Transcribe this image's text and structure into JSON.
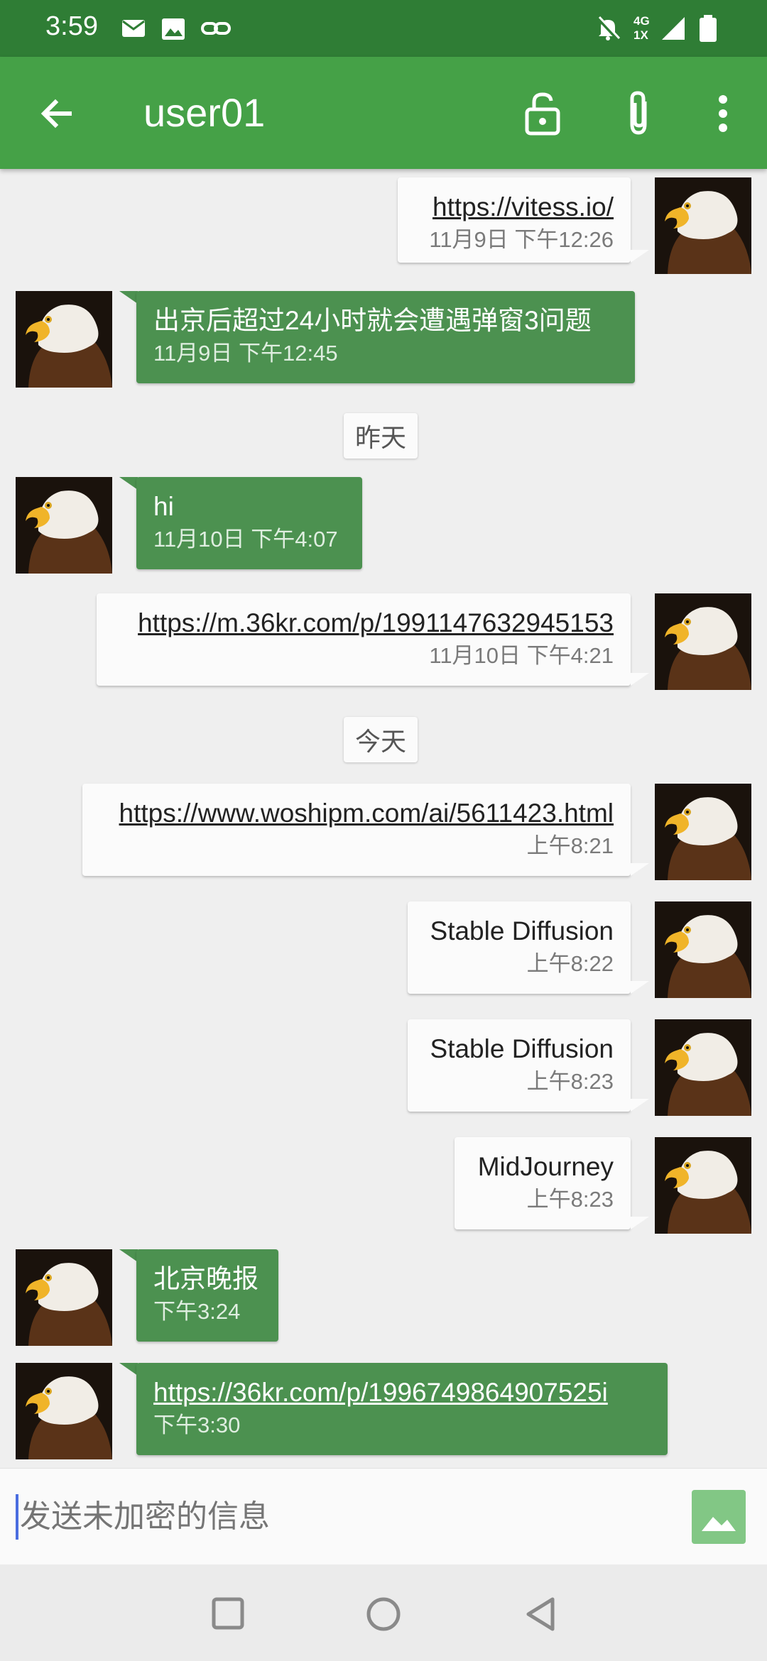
{
  "status_bar": {
    "time": "3:59",
    "network": "4G 1X",
    "icons": [
      "mail-icon",
      "image-icon",
      "link-icon",
      "mute-icon",
      "signal-icon",
      "battery-icon"
    ]
  },
  "app_bar": {
    "title": "user01",
    "icons": [
      "back-arrow-icon",
      "unlock-icon",
      "attachment-icon",
      "more-vert-icon"
    ]
  },
  "colors": {
    "status_bar": "#2f7d35",
    "app_bar": "#45a147",
    "incoming_bubble": "#4c9150",
    "outgoing_bubble": "#fbfbfb",
    "background": "#efefef"
  },
  "messages": [
    {
      "dir": "out",
      "text": "https://vitess.io/",
      "time": "11月9日 下午12:26",
      "link": true
    },
    {
      "dir": "in",
      "text": "出京后超过24小时就会遭遇弹窗3问题",
      "time": "11月9日 下午12:45",
      "link": false
    },
    {
      "separator": "昨天"
    },
    {
      "dir": "in",
      "text": "hi",
      "time": "11月10日 下午4:07",
      "link": false
    },
    {
      "dir": "out",
      "text": "https://m.36kr.com/p/1991147632945153",
      "time": "11月10日 下午4:21",
      "link": true
    },
    {
      "separator": "今天"
    },
    {
      "dir": "out",
      "text": "https://www.woshipm.com/ai/5611423.html",
      "time": "上午8:21",
      "link": true
    },
    {
      "dir": "out",
      "text": "Stable Diffusion",
      "time": "上午8:22",
      "link": false
    },
    {
      "dir": "out",
      "text": "Stable Diffusion",
      "time": "上午8:23",
      "link": false
    },
    {
      "dir": "out",
      "text": "MidJourney",
      "time": "上午8:23",
      "link": false
    },
    {
      "dir": "in",
      "text": "北京晚报",
      "time": "下午3:24",
      "link": false
    },
    {
      "dir": "in",
      "text": "https://36kr.com/p/1996749864907525i",
      "time": "下午3:30",
      "link": true
    }
  ],
  "composer": {
    "placeholder": "发送未加密的信息",
    "send_image_icon": "image-icon"
  },
  "nav_bar": {
    "icons": [
      "recents-square-icon",
      "home-circle-icon",
      "back-triangle-icon"
    ]
  }
}
